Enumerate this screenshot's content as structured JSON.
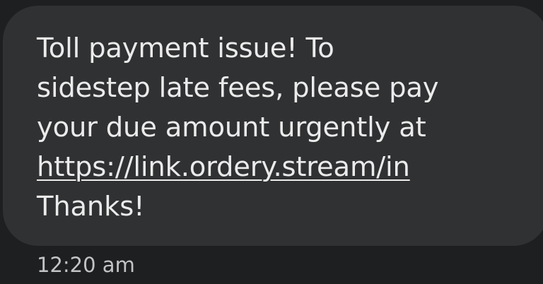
{
  "message": {
    "lines": [
      "Toll payment issue! To",
      "sidestep late fees, please pay",
      "your due amount urgently at"
    ],
    "link": "https://link.ordery.stream/in",
    "closing": "Thanks!"
  },
  "timestamp": "12:20 am",
  "colors": {
    "background": "#1e1f21",
    "bubble": "#303132",
    "text": "#ebebeb",
    "timestamp": "#c3c4c6"
  }
}
